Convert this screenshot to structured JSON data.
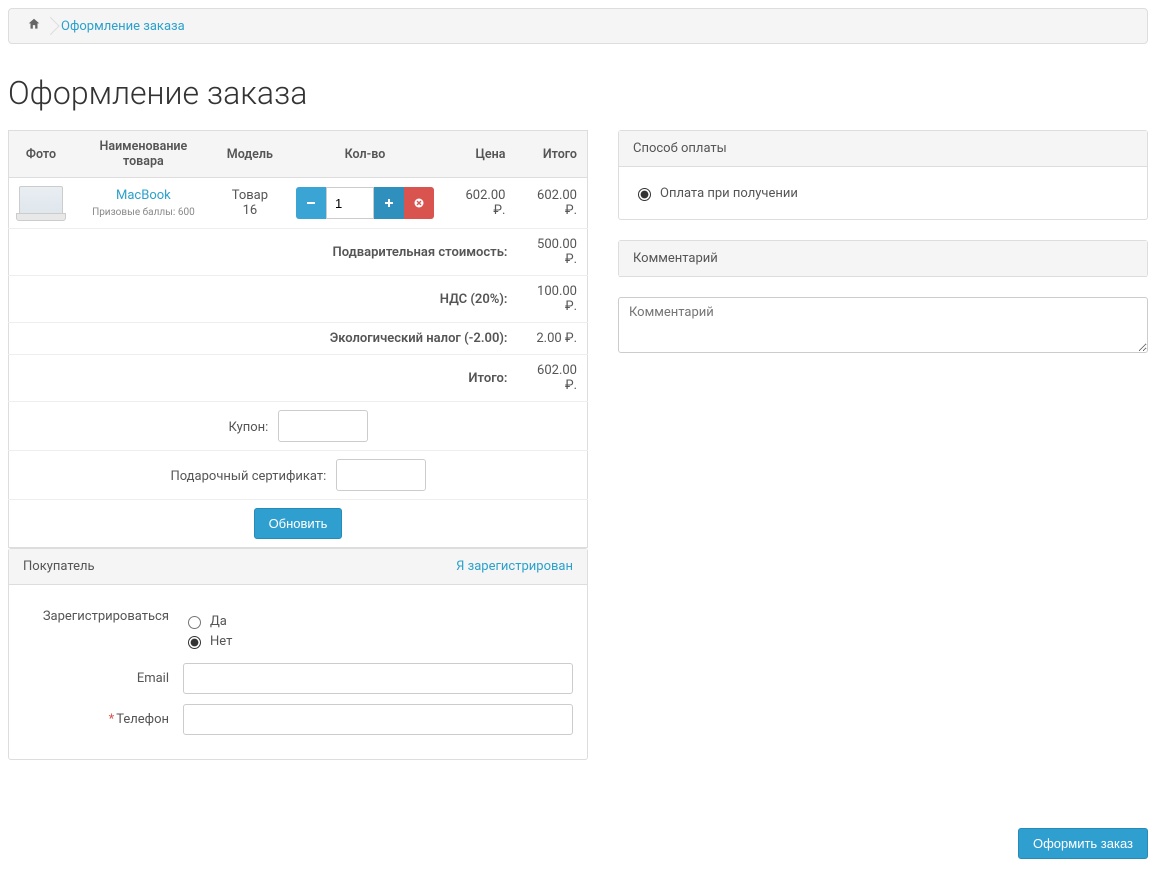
{
  "breadcrumb": {
    "current": "Оформление заказа"
  },
  "page_title": "Оформление заказа",
  "cart": {
    "headers": {
      "photo": "Фото",
      "name": "Наименование товара",
      "model": "Модель",
      "qty": "Кол-во",
      "price": "Цена",
      "total": "Итого"
    },
    "item": {
      "name": "MacBook",
      "reward_label": "Призовые баллы: 600",
      "model": "Товар 16",
      "qty": "1",
      "price": "602.00 ₽.",
      "total": "602.00 ₽."
    },
    "totals": {
      "subtotal_label": "Подварительная стоимость:",
      "subtotal_value": "500.00 ₽.",
      "vat_label": "НДС (20%):",
      "vat_value": "100.00 ₽.",
      "eco_label": "Экологический налог (-2.00):",
      "eco_value": "2.00 ₽.",
      "total_label": "Итого:",
      "total_value": "602.00 ₽."
    },
    "coupon_label": "Купон:",
    "voucher_label": "Подарочный сертификат:",
    "update_btn": "Обновить"
  },
  "customer_panel": {
    "title": "Покупатель",
    "login_link": "Я зарегистрирован",
    "register_label": "Зарегистрироваться",
    "register_yes": "Да",
    "register_no": "Нет",
    "email_label": "Email",
    "phone_label": "Телефон"
  },
  "payment_panel": {
    "title": "Способ оплаты",
    "cod_label": "Оплата при получении"
  },
  "comment_panel": {
    "title": "Комментарий",
    "placeholder": "Комментарий"
  },
  "checkout_btn": "Оформить заказ"
}
